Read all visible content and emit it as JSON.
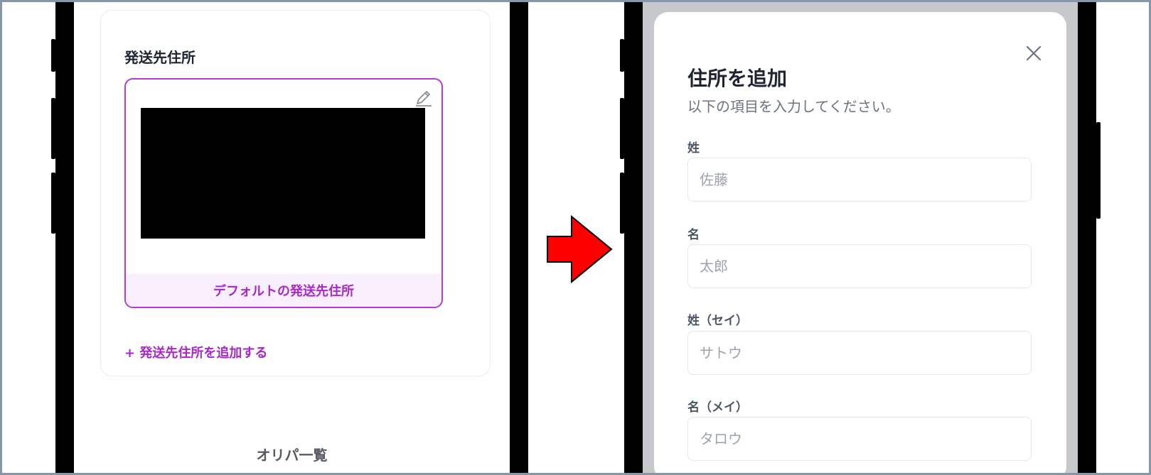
{
  "left_screen": {
    "section_title": "発送先住所",
    "address_badge": "デフォルトの発送先住所",
    "add_address_link": "+ 発送先住所を追加する",
    "bottom_nav_label": "オリパ一覧"
  },
  "arrow": {
    "color": "#ff0000"
  },
  "modal": {
    "title": "住所を追加",
    "subtitle": "以下の項目を入力してください。",
    "fields": [
      {
        "label": "姓",
        "placeholder": "佐藤",
        "value": ""
      },
      {
        "label": "名",
        "placeholder": "太郎",
        "value": ""
      },
      {
        "label": "姓（セイ）",
        "placeholder": "サトウ",
        "value": ""
      },
      {
        "label": "名（メイ）",
        "placeholder": "タロウ",
        "value": ""
      }
    ]
  },
  "colors": {
    "accent": "#a728c9",
    "accent_bg": "#f9eefc",
    "overlay": "#c7c8cc"
  },
  "icons": {
    "edit": "pencil-icon",
    "close": "close-icon"
  }
}
